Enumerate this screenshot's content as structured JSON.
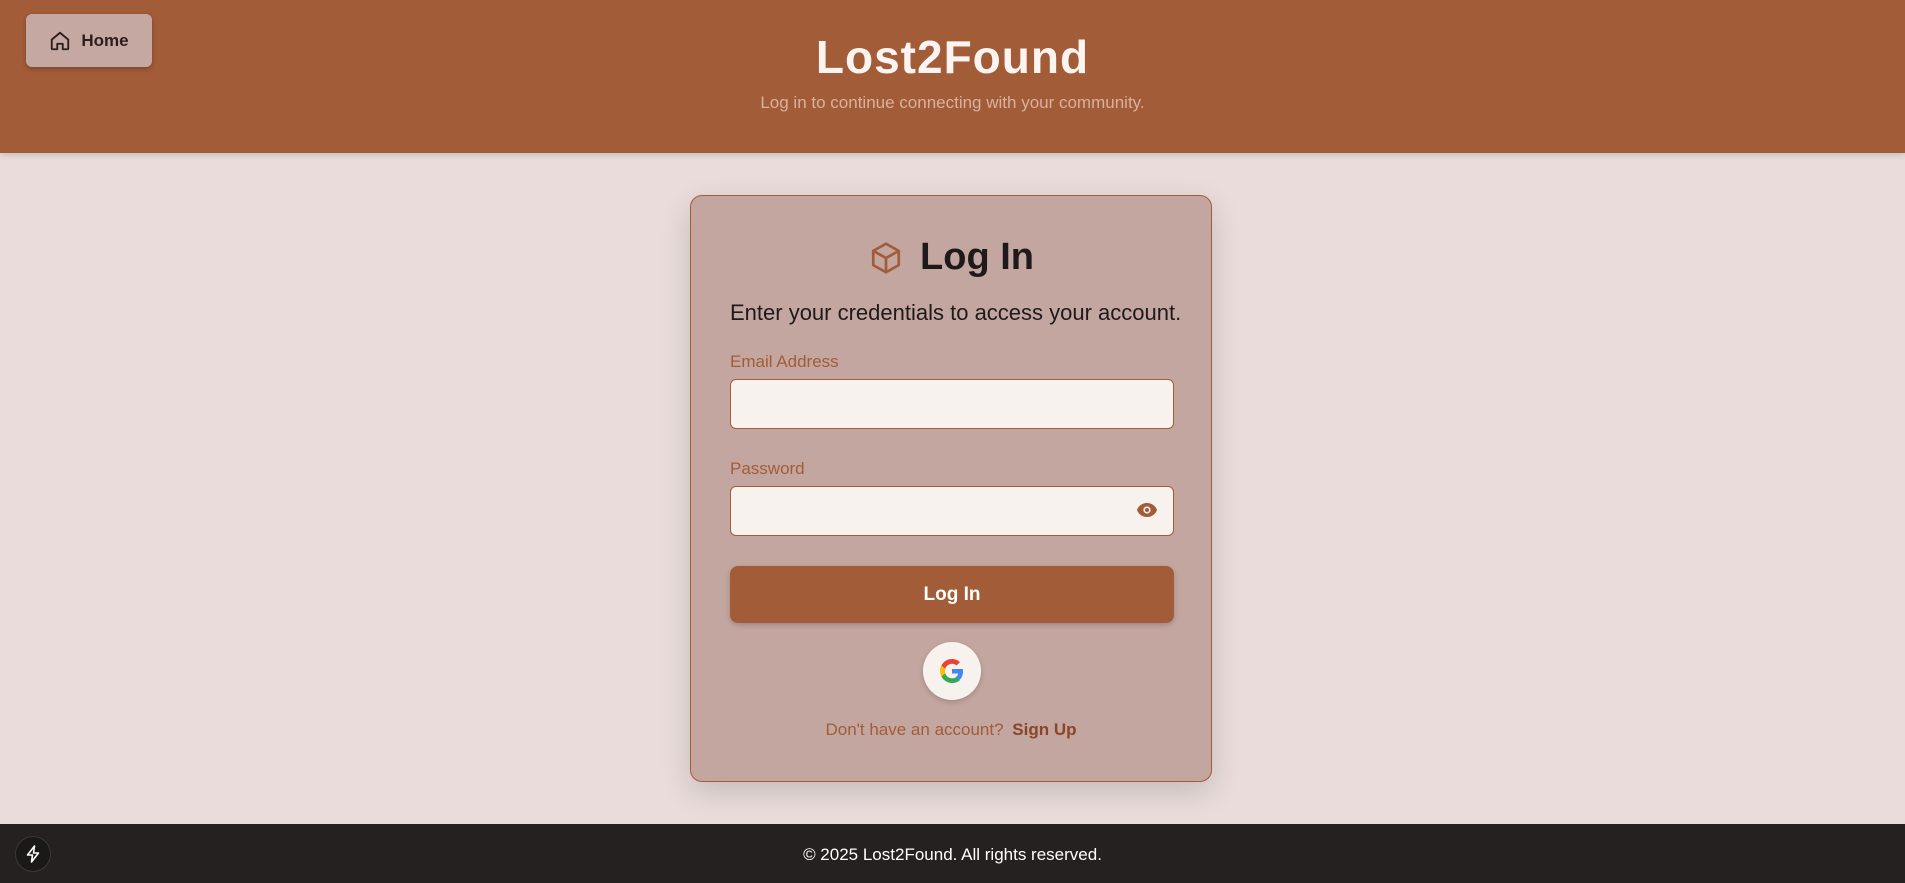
{
  "header": {
    "home_label": "Home",
    "title": "Lost2Found",
    "subtitle": "Log in to continue connecting with your community."
  },
  "card": {
    "title": "Log In",
    "description": "Enter your credentials to access your account.",
    "email_label": "Email Address",
    "email_value": "",
    "password_label": "Password",
    "password_value": "",
    "login_button": "Log In",
    "signup_prompt": "Don't have an account?",
    "signup_link": "Sign Up"
  },
  "footer": {
    "text": "© 2025 Lost2Found. All rights reserved."
  },
  "icons": {
    "home": "home-icon",
    "card_title": "package-icon",
    "password_toggle": "eye-icon",
    "google": "google-icon",
    "dev_tools": "bolt-icon"
  },
  "colors": {
    "brand": "#a25c38",
    "background": "#e9dcdb",
    "card": "#c4a6a0",
    "footer": "#242120"
  }
}
